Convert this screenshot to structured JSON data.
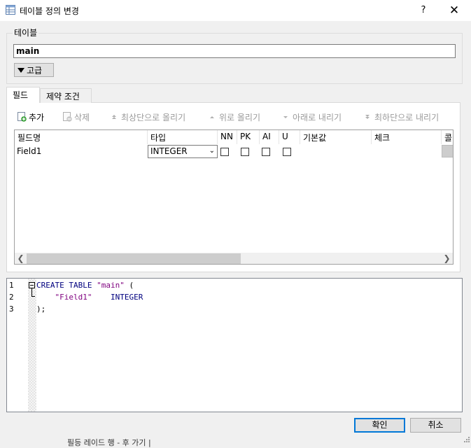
{
  "window": {
    "title": "테이블 정의 변경",
    "help_label": "?",
    "close_label": "✕"
  },
  "table_group": {
    "label": "테이블",
    "name_value": "main",
    "advanced_label": "고급"
  },
  "tabs": [
    {
      "label": "필드",
      "active": true
    },
    {
      "label": "제약 조건",
      "active": false
    }
  ],
  "toolbar": {
    "add": "추가",
    "delete": "삭제",
    "move_top": "최상단으로 올리기",
    "move_up": "위로 올리기",
    "move_down": "아래로 내리기",
    "move_bottom": "최하단으로 내리기"
  },
  "grid": {
    "columns": [
      "필드명",
      "타입",
      "NN",
      "PK",
      "AI",
      "U",
      "기본값",
      "체크",
      "콜"
    ],
    "rows": [
      {
        "name": "Field1",
        "type": "INTEGER",
        "nn": false,
        "pk": false,
        "ai": false,
        "u": false,
        "default": "",
        "check": ""
      }
    ]
  },
  "sql": {
    "line_numbers": [
      "1",
      "2",
      "3"
    ],
    "line1": {
      "kw": "CREATE TABLE",
      "str": "\"main\"",
      "rest": " ("
    },
    "line2": {
      "indent": "    ",
      "str": "\"Field1\"",
      "gap": "    ",
      "kw": "INTEGER"
    },
    "line3": ");"
  },
  "buttons": {
    "ok": "확인",
    "cancel": "취소"
  },
  "background_text": "필등 레이드 행 - 후 가기 |"
}
